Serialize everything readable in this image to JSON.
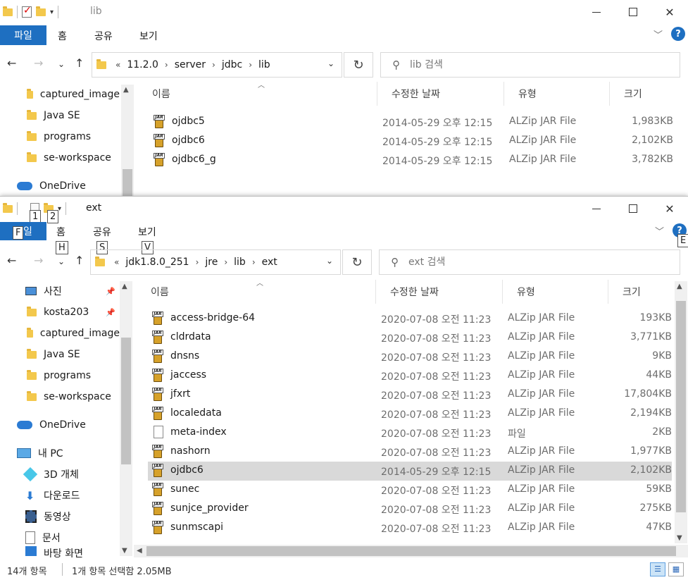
{
  "back_window": {
    "title": "lib",
    "ribbon": {
      "file": "파일",
      "tabs": [
        "홈",
        "공유",
        "보기"
      ]
    },
    "breadcrumb": {
      "prefix": "«",
      "parts": [
        "11.2.0",
        "server",
        "jdbc",
        "lib"
      ]
    },
    "search_placeholder": "lib 검색",
    "nav_items": [
      {
        "label": "captured_image",
        "icon": "folder-icon"
      },
      {
        "label": "Java SE",
        "icon": "folder-icon"
      },
      {
        "label": "programs",
        "icon": "folder-icon"
      },
      {
        "label": "se-workspace",
        "icon": "folder-icon"
      },
      {
        "label": "OneDrive",
        "icon": "cloud-icon"
      }
    ],
    "columns": [
      "이름",
      "수정한 날짜",
      "유형",
      "크기"
    ],
    "files": [
      {
        "name": "ojdbc5",
        "date": "2014-05-29 오후 12:15",
        "type": "ALZip JAR File",
        "size": "1,983KB"
      },
      {
        "name": "ojdbc6",
        "date": "2014-05-29 오후 12:15",
        "type": "ALZip JAR File",
        "size": "2,102KB"
      },
      {
        "name": "ojdbc6_g",
        "date": "2014-05-29 오후 12:15",
        "type": "ALZip JAR File",
        "size": "3,782KB"
      }
    ]
  },
  "front_window": {
    "title": "ext",
    "ribbon": {
      "file": "파일",
      "tabs": [
        "홈",
        "공유",
        "보기"
      ]
    },
    "keytips": {
      "file": "F",
      "qat1": "1",
      "qat2": "2",
      "home": "H",
      "share": "S",
      "view": "V",
      "extra": "E"
    },
    "breadcrumb": {
      "prefix": "«",
      "parts": [
        "jdk1.8.0_251",
        "jre",
        "lib",
        "ext"
      ]
    },
    "search_placeholder": "ext 검색",
    "nav_items": [
      {
        "label": "사진",
        "icon": "pictures-icon",
        "pinned": true
      },
      {
        "label": "kosta203",
        "icon": "folder-icon",
        "pinned": true
      },
      {
        "label": "captured_image",
        "icon": "folder-icon",
        "pinned": false
      },
      {
        "label": "Java SE",
        "icon": "folder-icon",
        "pinned": false
      },
      {
        "label": "programs",
        "icon": "folder-icon",
        "pinned": false
      },
      {
        "label": "se-workspace",
        "icon": "folder-icon",
        "pinned": false
      },
      {
        "label": "OneDrive",
        "icon": "cloud-icon",
        "pinned": false
      },
      {
        "label": "내 PC",
        "icon": "pc-icon",
        "pinned": false
      },
      {
        "label": "3D 개체",
        "icon": "cube-icon",
        "pinned": false
      },
      {
        "label": "다운로드",
        "icon": "download-icon",
        "pinned": false
      },
      {
        "label": "동영상",
        "icon": "video-icon",
        "pinned": false
      },
      {
        "label": "문서",
        "icon": "document-icon",
        "pinned": false
      },
      {
        "label": "바탕 화면",
        "icon": "desktop-icon",
        "pinned": false
      }
    ],
    "columns": [
      "이름",
      "수정한 날짜",
      "유형",
      "크기"
    ],
    "files": [
      {
        "name": "access-bridge-64",
        "date": "2020-07-08 오전 11:23",
        "type": "ALZip JAR File",
        "size": "193KB",
        "icon": "jar"
      },
      {
        "name": "cldrdata",
        "date": "2020-07-08 오전 11:23",
        "type": "ALZip JAR File",
        "size": "3,771KB",
        "icon": "jar"
      },
      {
        "name": "dnsns",
        "date": "2020-07-08 오전 11:23",
        "type": "ALZip JAR File",
        "size": "9KB",
        "icon": "jar"
      },
      {
        "name": "jaccess",
        "date": "2020-07-08 오전 11:23",
        "type": "ALZip JAR File",
        "size": "44KB",
        "icon": "jar"
      },
      {
        "name": "jfxrt",
        "date": "2020-07-08 오전 11:23",
        "type": "ALZip JAR File",
        "size": "17,804KB",
        "icon": "jar"
      },
      {
        "name": "localedata",
        "date": "2020-07-08 오전 11:23",
        "type": "ALZip JAR File",
        "size": "2,194KB",
        "icon": "jar"
      },
      {
        "name": "meta-index",
        "date": "2020-07-08 오전 11:23",
        "type": "파일",
        "size": "2KB",
        "icon": "file"
      },
      {
        "name": "nashorn",
        "date": "2020-07-08 오전 11:23",
        "type": "ALZip JAR File",
        "size": "1,977KB",
        "icon": "jar"
      },
      {
        "name": "ojdbc6",
        "date": "2014-05-29 오후 12:15",
        "type": "ALZip JAR File",
        "size": "2,102KB",
        "icon": "jar",
        "selected": true
      },
      {
        "name": "sunec",
        "date": "2020-07-08 오전 11:23",
        "type": "ALZip JAR File",
        "size": "59KB",
        "icon": "jar"
      },
      {
        "name": "sunjce_provider",
        "date": "2020-07-08 오전 11:23",
        "type": "ALZip JAR File",
        "size": "275KB",
        "icon": "jar"
      },
      {
        "name": "sunmscapi",
        "date": "2020-07-08 오전 11:23",
        "type": "ALZip JAR File",
        "size": "47KB",
        "icon": "jar"
      }
    ],
    "status": {
      "count": "14개 항목",
      "selection": "1개 항목 선택함 2.05MB"
    }
  },
  "colors": {
    "accent": "#1e6fc1",
    "selection": "#d9d9d9",
    "folder": "#f3c84c"
  }
}
